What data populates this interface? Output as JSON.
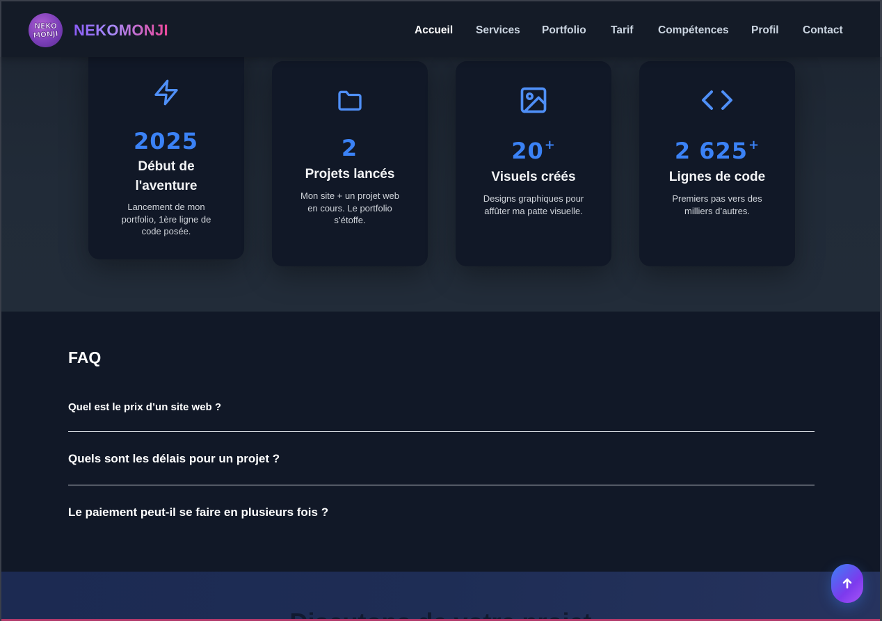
{
  "header": {
    "logo_text": "NEKO MONJI",
    "brand": "NEKOMONJI",
    "nav": [
      {
        "label": "Accueil",
        "active": true
      },
      {
        "label": "Services"
      },
      {
        "label": "Portfolio"
      },
      {
        "label": "Tarif"
      },
      {
        "label": "Compétences"
      },
      {
        "label": "Profil"
      },
      {
        "label": "Contact"
      }
    ]
  },
  "stats": [
    {
      "icon": "lightning-icon",
      "number": "2025",
      "suffix": "",
      "title_lines": [
        "Début de",
        "l'aventure"
      ],
      "desc_lines": [
        "Lancement de mon",
        "portfolio, 1ère ligne de",
        "code posée."
      ]
    },
    {
      "icon": "folder-icon",
      "number": "2",
      "suffix": "",
      "title_lines": [
        "Projets lancés"
      ],
      "desc_lines": [
        "Mon site + un projet web",
        "en cours. Le portfolio",
        "s’étoffe."
      ]
    },
    {
      "icon": "image-icon",
      "number": "20",
      "suffix": "+",
      "title_lines": [
        "Visuels créés"
      ],
      "desc_lines": [
        "Designs graphiques pour",
        "affûter ma patte visuelle."
      ]
    },
    {
      "icon": "code-icon",
      "number": "2 625",
      "suffix": "+",
      "title_lines": [
        "Lignes de code"
      ],
      "desc_lines": [
        "Premiers pas vers des",
        "milliers d’autres."
      ]
    }
  ],
  "faq": {
    "title": "FAQ",
    "questions": [
      "Quel est le prix d’un site web ?",
      "Quels sont les délais pour un projet ?",
      "Le paiement peut-il se faire en plusieurs fois ?"
    ]
  },
  "bottom": {
    "heading": "Discutons de votre projet"
  },
  "colors": {
    "accent": "#3b82f6",
    "card_bg": "#111827",
    "brand_gradient_start": "#8b5cf6",
    "brand_gradient_end": "#ec4899"
  }
}
